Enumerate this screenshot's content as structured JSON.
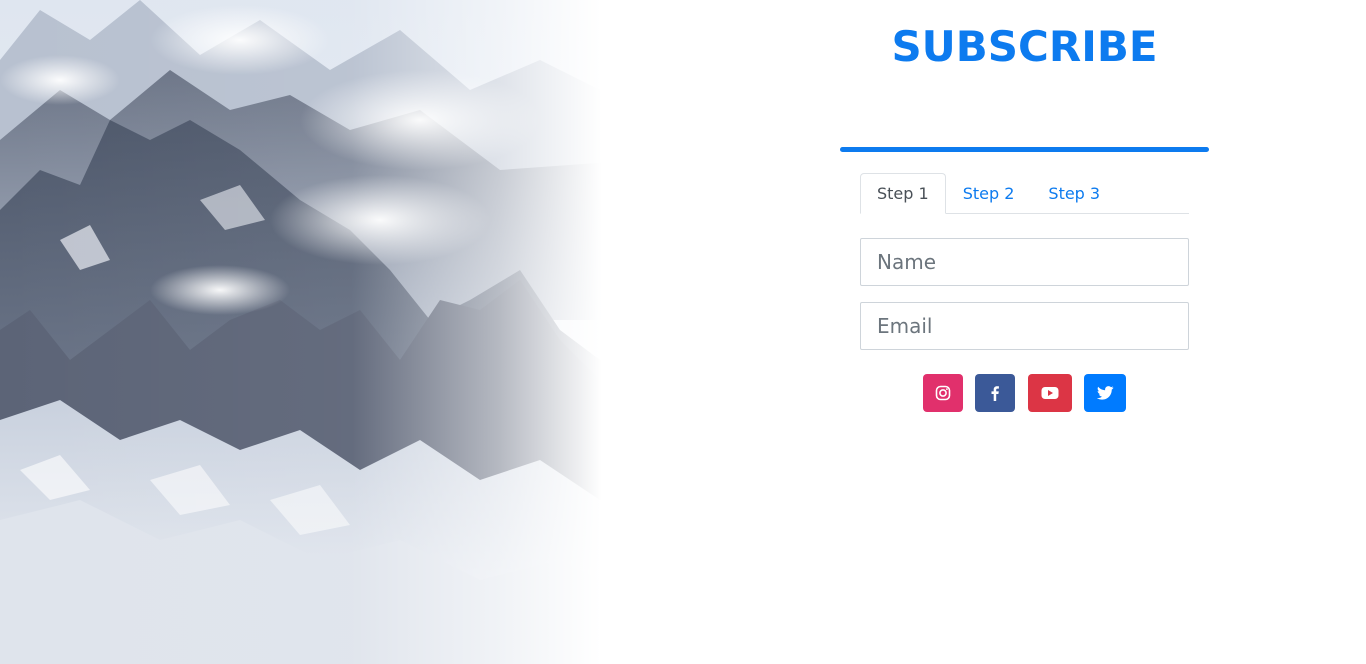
{
  "header": {
    "title": "SUBSCRIBE"
  },
  "colors": {
    "accent": "#0d7bef",
    "instagram": "#e1306c",
    "facebook": "#3b5998",
    "youtube": "#dc3545",
    "twitter": "#007bff"
  },
  "progress": {
    "value_percent": 100
  },
  "tabs": [
    {
      "label": "Step 1",
      "active": true
    },
    {
      "label": "Step 2",
      "active": false
    },
    {
      "label": "Step 3",
      "active": false
    }
  ],
  "form": {
    "name_placeholder": "Name",
    "email_placeholder": "Email",
    "name_value": "",
    "email_value": ""
  },
  "social": [
    {
      "icon": "instagram-icon"
    },
    {
      "icon": "facebook-icon"
    },
    {
      "icon": "youtube-icon"
    },
    {
      "icon": "twitter-icon"
    }
  ]
}
